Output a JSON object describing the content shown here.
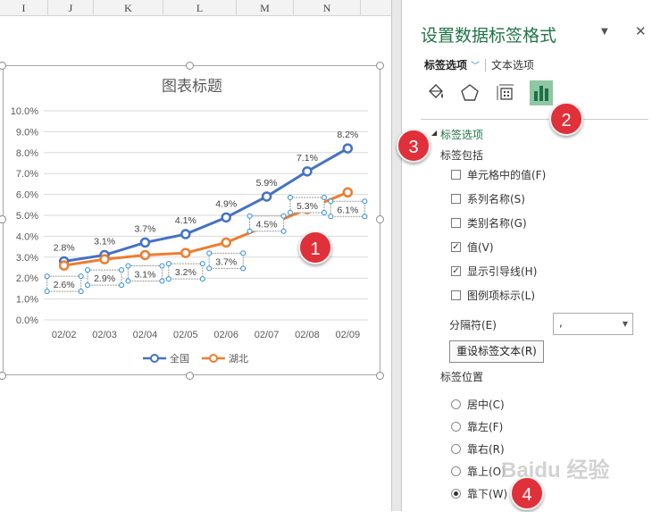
{
  "sheet": {
    "columns": [
      "I",
      "J",
      "K",
      "L",
      "M",
      "N"
    ]
  },
  "chart_data": {
    "type": "line",
    "title": "图表标题",
    "categories": [
      "02/02",
      "02/03",
      "02/04",
      "02/05",
      "02/06",
      "02/07",
      "02/08",
      "02/09"
    ],
    "series": [
      {
        "name": "全国",
        "values": [
          2.8,
          3.1,
          3.7,
          4.1,
          4.9,
          5.9,
          7.1,
          8.2
        ],
        "labels": [
          "2.8%",
          "3.1%",
          "3.7%",
          "4.1%",
          "4.9%",
          "5.9%",
          "7.1%",
          "8.2%"
        ],
        "color": "#4472c4"
      },
      {
        "name": "湖北",
        "values": [
          2.6,
          2.9,
          3.1,
          3.2,
          3.7,
          4.5,
          5.3,
          6.1
        ],
        "labels": [
          "2.6%",
          "2.9%",
          "3.1%",
          "3.2%",
          "3.7%",
          "4.5%",
          "5.3%",
          "6.1%"
        ],
        "color": "#ed7d31"
      }
    ],
    "ylim": [
      0,
      10
    ],
    "yticks": [
      "0.0%",
      "1.0%",
      "2.0%",
      "3.0%",
      "4.0%",
      "5.0%",
      "6.0%",
      "7.0%",
      "8.0%",
      "9.0%",
      "10.0%"
    ],
    "grid": true,
    "legend": "bottom"
  },
  "pane": {
    "title": "设置数据标签格式",
    "tabs": {
      "active": "标签选项",
      "other": "文本选项"
    },
    "icons": [
      "paint-bucket-icon",
      "pentagon-icon",
      "size-properties-icon",
      "bar-chart-icon"
    ],
    "section": "标签选项",
    "includes_label": "标签包括",
    "checkboxes": [
      {
        "label": "单元格中的值(F)",
        "checked": false
      },
      {
        "label": "系列名称(S)",
        "checked": false
      },
      {
        "label": "类别名称(G)",
        "checked": false
      },
      {
        "label": "值(V)",
        "checked": true
      },
      {
        "label": "显示引导线(H)",
        "checked": true
      },
      {
        "label": "图例项标示(L)",
        "checked": false
      }
    ],
    "separator_label": "分隔符(E)",
    "separator_value": ",",
    "reset_button": "重设标签文本(R)",
    "position_label": "标签位置",
    "radios": [
      {
        "label": "居中(C)",
        "selected": false
      },
      {
        "label": "靠左(F)",
        "selected": false
      },
      {
        "label": "靠右(R)",
        "selected": false
      },
      {
        "label": "靠上(O)",
        "selected": false
      },
      {
        "label": "靠下(W)",
        "selected": true
      }
    ]
  },
  "annotations": [
    "1",
    "2",
    "3",
    "4"
  ],
  "watermark": "Baidu 经验"
}
